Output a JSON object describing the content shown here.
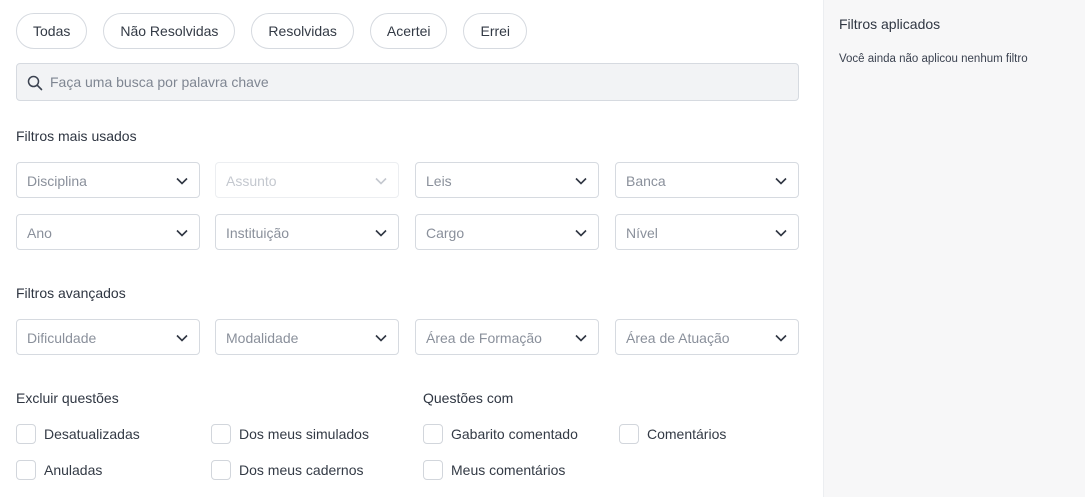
{
  "pills": [
    "Todas",
    "Não Resolvidas",
    "Resolvidas",
    "Acertei",
    "Errei"
  ],
  "search": {
    "placeholder": "Faça uma busca por palavra chave",
    "value": ""
  },
  "filtros_mais_usados": {
    "title": "Filtros mais usados",
    "row1": [
      "Disciplina",
      "Assunto",
      "Leis",
      "Banca"
    ],
    "row2": [
      "Ano",
      "Instituição",
      "Cargo",
      "Nível"
    ]
  },
  "filtros_avancados": {
    "title": "Filtros avançados",
    "row": [
      "Dificuldade",
      "Modalidade",
      "Área de Formação",
      "Área de Atuação"
    ]
  },
  "excluir_questoes": {
    "title": "Excluir questões",
    "items": [
      "Desatualizadas",
      "Dos meus simulados",
      "Anuladas",
      "Dos meus cadernos"
    ]
  },
  "questoes_com": {
    "title": "Questões com",
    "items": [
      "Gabarito comentado",
      "Comentários",
      "Meus comentários"
    ]
  },
  "sidebar": {
    "title": "Filtros aplicados",
    "empty_text": "Você ainda não aplicou nenhum filtro"
  },
  "icons": {
    "search": "search-icon",
    "dropdown": "chevron-down-icon"
  }
}
